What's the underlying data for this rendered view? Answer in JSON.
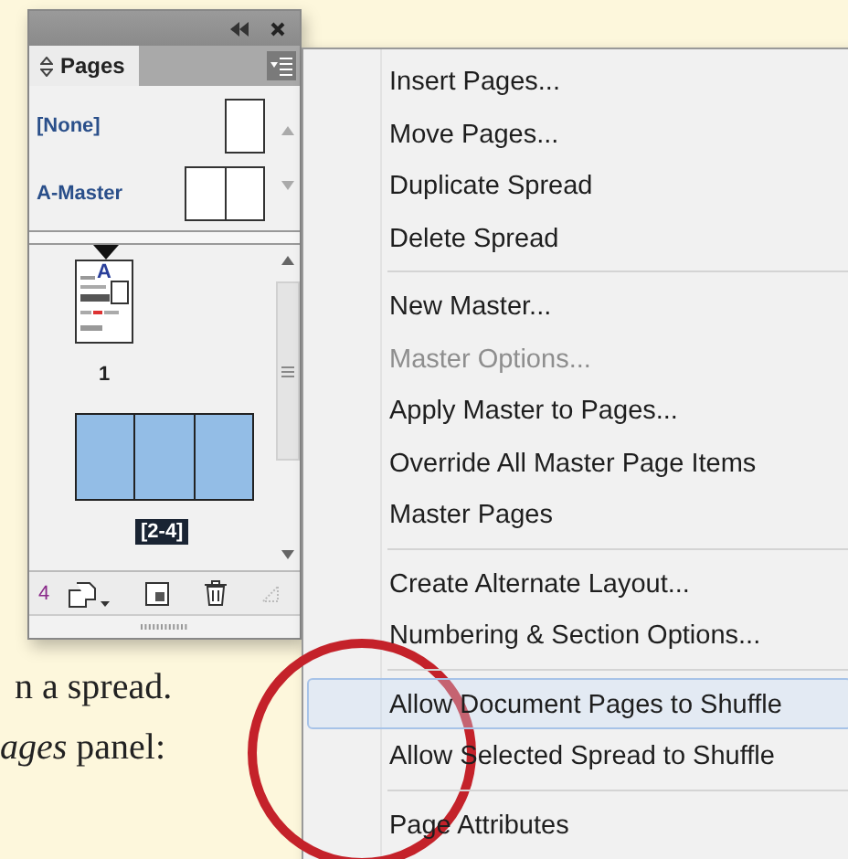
{
  "panel": {
    "tab": {
      "label": "Pages",
      "selected": true
    },
    "masters": [
      {
        "label": "[None]",
        "kind": "single"
      },
      {
        "label": "A-Master",
        "kind": "spread"
      }
    ],
    "pages": [
      {
        "label": "1",
        "kind": "document",
        "master_prefix": "A",
        "selected": false
      },
      {
        "label": "[2-4]",
        "kind": "spread",
        "selected": true
      }
    ],
    "footer": {
      "count": "4"
    }
  },
  "menu": {
    "groups": [
      [
        {
          "label": "Insert Pages...",
          "disabled": false,
          "highlighted": false
        },
        {
          "label": "Move Pages...",
          "disabled": false,
          "highlighted": false
        },
        {
          "label": "Duplicate Spread",
          "disabled": false,
          "highlighted": false
        },
        {
          "label": "Delete Spread",
          "disabled": false,
          "highlighted": false
        }
      ],
      [
        {
          "label": "New Master...",
          "disabled": false,
          "highlighted": false
        },
        {
          "label": "Master Options...",
          "disabled": true,
          "highlighted": false
        },
        {
          "label": "Apply Master to Pages...",
          "disabled": false,
          "highlighted": false
        },
        {
          "label": "Override All Master Page Items",
          "disabled": false,
          "highlighted": false
        },
        {
          "label": "Master Pages",
          "disabled": false,
          "highlighted": false
        }
      ],
      [
        {
          "label": "Create Alternate Layout...",
          "disabled": false,
          "highlighted": false
        },
        {
          "label": "Numbering & Section Options...",
          "disabled": false,
          "highlighted": false
        }
      ],
      [
        {
          "label": "Allow Document Pages to Shuffle",
          "disabled": false,
          "highlighted": true
        },
        {
          "label": "Allow Selected Spread to Shuffle",
          "disabled": false,
          "highlighted": false
        }
      ],
      [
        {
          "label": "Page Attributes",
          "disabled": false,
          "highlighted": false
        }
      ]
    ]
  },
  "body_text": [
    "n a spread.",
    "*ages* panel:"
  ]
}
